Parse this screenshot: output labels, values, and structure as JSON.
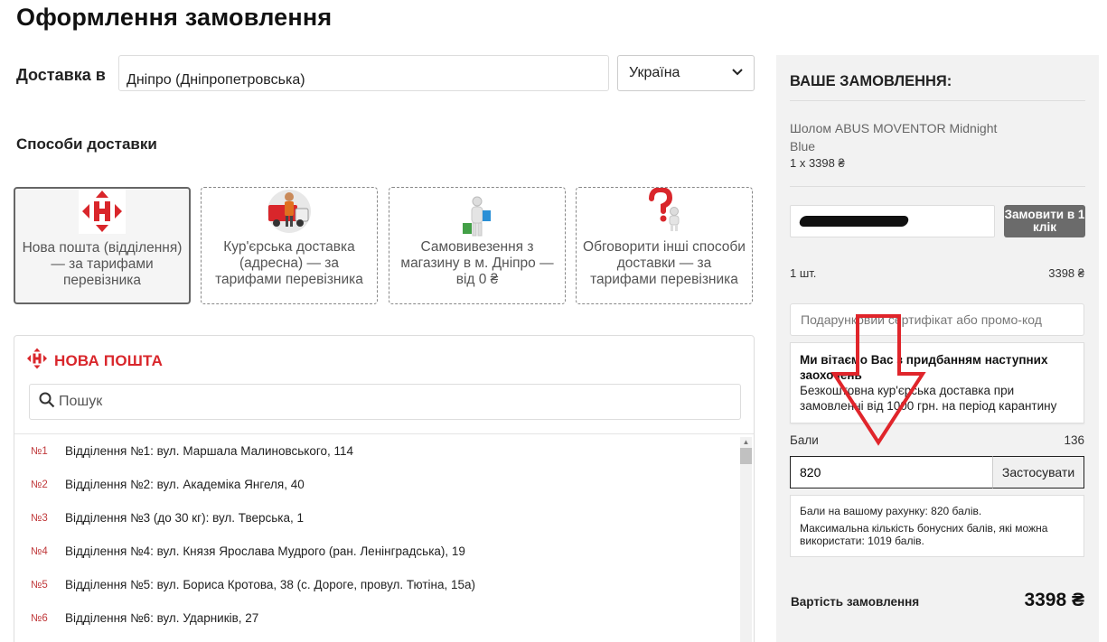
{
  "page": {
    "title": "Оформлення замовлення"
  },
  "delivery": {
    "label": "Доставка в",
    "city": "Дніпро (Дніпропетровська)",
    "country": "Україна"
  },
  "methods": {
    "title": "Способи доставки",
    "items": [
      {
        "label": "Нова пошта (відділення) — за тарифами перевізника",
        "icon": "nova-poshta-logo-icon",
        "active": true
      },
      {
        "label": "Кур'єрська доставка (адресна) — за тарифами перевізника",
        "icon": "courier-icon",
        "active": false
      },
      {
        "label": "Самовивезення з магазину в м. Дніпро — від 0 ₴",
        "icon": "pickup-person-icon",
        "active": false
      },
      {
        "label": "Обговорити інші способи доставки — за тарифами перевізника",
        "icon": "question-person-icon",
        "active": false
      }
    ]
  },
  "nova_poshta": {
    "logo_text": "НОВА ПОШТА",
    "search_placeholder": "Пошук",
    "branches": [
      {
        "num": "№1",
        "address": "Відділення №1: вул. Маршала Малиновського, 114"
      },
      {
        "num": "№2",
        "address": "Відділення №2: вул. Академіка Янгеля, 40"
      },
      {
        "num": "№3",
        "address": "Відділення №3 (до 30 кг): вул. Тверська, 1"
      },
      {
        "num": "№4",
        "address": "Відділення №4: вул. Князя Ярослава Мудрого (ран. Ленінградська), 19"
      },
      {
        "num": "№5",
        "address": "Відділення №5: вул. Бориса Кротова, 38 (с. Дороге, провул. Тютіна, 15а)"
      },
      {
        "num": "№6",
        "address": "Відділення №6: вул. Ударників, 27"
      }
    ]
  },
  "order": {
    "title": "ВАШЕ ЗАМОВЛЕННЯ:",
    "product_name": "Шолом ABUS MOVENTOR Midnight Blue",
    "product_qty": "1 x 3398 ₴",
    "one_click_button": "Замовити в 1 клік",
    "summary_qty": "1 шт.",
    "summary_price": "3398 ₴",
    "promo_placeholder": "Подарунковий сертифікат або промо-код",
    "bonus_title": "Ми вітаємо Вас з придбанням наступних заохочень",
    "bonus_text": "Безкоштовна кур'єрська доставка при замовленні від 1000 грн. на період карантину",
    "points_label": "Бали",
    "points_value": "136",
    "points_input": "820",
    "apply_button": "Застосувати",
    "balance_line1": "Бали на вашому рахунку: 820 балів.",
    "balance_line2": "Максимальна кількість бонусних балів, які можна використати: 1019 балів.",
    "total_label": "Вартість замовлення",
    "total_value": "3398 ₴"
  },
  "colors": {
    "brand_red": "#d9262b",
    "annotation_red": "#e0252b",
    "sidebar_bg": "#f2f2f2"
  }
}
